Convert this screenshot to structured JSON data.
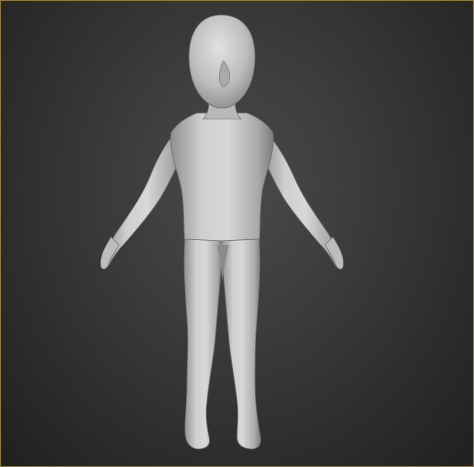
{
  "viewport": {
    "view_type": "perspective",
    "shading": "default-shading",
    "selection_border_color": "#8a7a4a"
  },
  "scene": {
    "object": "character-base-mesh",
    "pose": "a-pose",
    "material_color": "#c9c9c9",
    "background_colors": [
      "#4a4a4a",
      "#202020"
    ]
  }
}
